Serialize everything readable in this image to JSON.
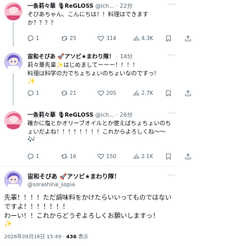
{
  "tweets": [
    {
      "name": "一条莉々華",
      "name_suffix": "ReGLOSS",
      "handle": "@ich...",
      "time": "22分",
      "text": "そびあちゃん、こんにちは！！料理はできますか？？？？",
      "replies": "1",
      "reposts": "25",
      "likes": "314",
      "views": "4.3K"
    },
    {
      "name": "宙和そびあ",
      "name_suffix": "アソビ★まわり隊！",
      "handle": "",
      "time": "14分",
      "text": "莉々華先輩✨はじめましてーーー！！！！\n料理は科学の力でちょちょいのちょいなのですっ！",
      "replies": "1",
      "reposts": "21",
      "likes": "205",
      "views": "2.7K"
    },
    {
      "name": "一条莉々華",
      "name_suffix": "ReGLOSS",
      "handle": "@ich...",
      "time": "26分",
      "text": "確かに塩とかオリーブオイルとか使えばちょちょいのちょいだよね！！！！！！！！これからよろしくね〜〜",
      "replies": "1",
      "reposts": "16",
      "likes": "150",
      "views": "2.1K"
    }
  ],
  "main_tweet": {
    "name": "宙和そびあ",
    "name_suffix": "アソビ★まわり隊！",
    "handle": "@sorashina_sopia",
    "text": "先輩！！！！ただ調味料をかけたらいいってものではないですよ！！！！！！！\nわーい！！これからどうぞよろしくお願いしますっ！",
    "date": "2026年09月18日 15:49",
    "views_count": "436",
    "views_label": "表示"
  },
  "colors": {
    "name": "#0f1419",
    "meta": "#536471",
    "thread": "#cfd9de",
    "star": "#f7c948"
  }
}
